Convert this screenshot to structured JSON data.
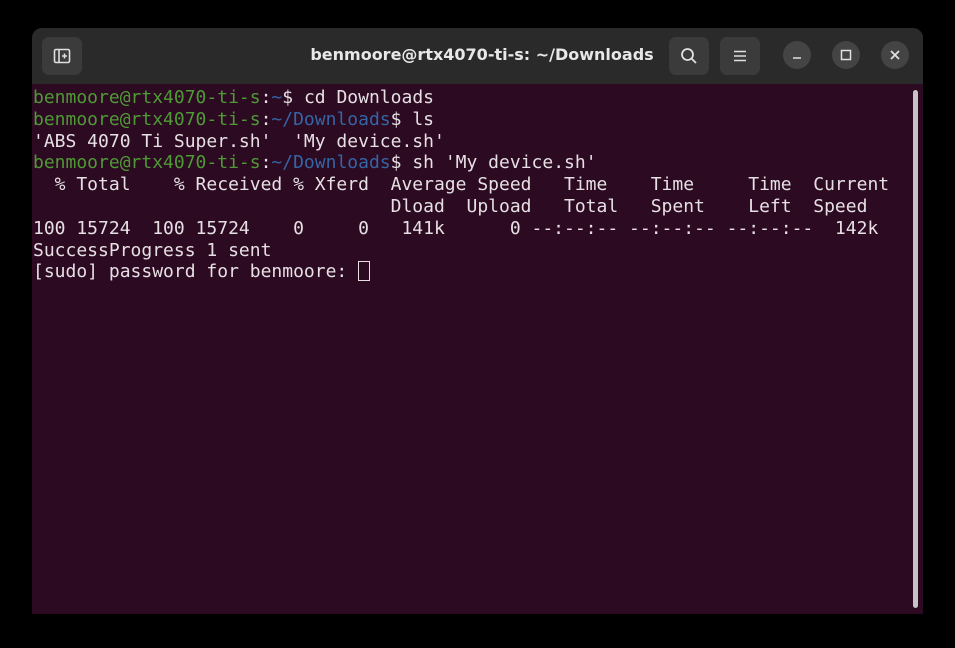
{
  "window": {
    "title": "benmoore@rtx4070-ti-s: ~/Downloads",
    "buttons": {
      "new_tab_icon": "new-tab-icon",
      "search_icon": "search-icon",
      "menu_icon": "hamburger-menu-icon",
      "minimize_icon": "minimize-icon",
      "maximize_icon": "maximize-icon",
      "close_icon": "close-icon"
    }
  },
  "colors": {
    "background": "#2c0a22",
    "user_host": "#4e9a35",
    "path": "#3465a4",
    "text": "#e6e0e4",
    "titlebar": "#2a2a2a"
  },
  "terminal": {
    "lines": [
      {
        "user": "benmoore@rtx4070-ti-s",
        "sep": ":",
        "path": "~",
        "prompt": "$ ",
        "cmd": "cd Downloads"
      },
      {
        "user": "benmoore@rtx4070-ti-s",
        "sep": ":",
        "path": "~/Downloads",
        "prompt": "$ ",
        "cmd": "ls"
      },
      {
        "text": "'ABS 4070 Ti Super.sh'  'My device.sh'"
      },
      {
        "user": "benmoore@rtx4070-ti-s",
        "sep": ":",
        "path": "~/Downloads",
        "prompt": "$ ",
        "cmd": "sh 'My device.sh'"
      },
      {
        "text": "  % Total    % Received % Xferd  Average Speed   Time    Time     Time  Current"
      },
      {
        "text": "                                 Dload  Upload   Total   Spent    Left  Speed"
      },
      {
        "text": "100 15724  100 15724    0     0   141k      0 --:--:-- --:--:-- --:--:--  142k"
      },
      {
        "text": "SuccessProgress 1 sent"
      },
      {
        "text": "[sudo] password for benmoore: "
      }
    ]
  }
}
